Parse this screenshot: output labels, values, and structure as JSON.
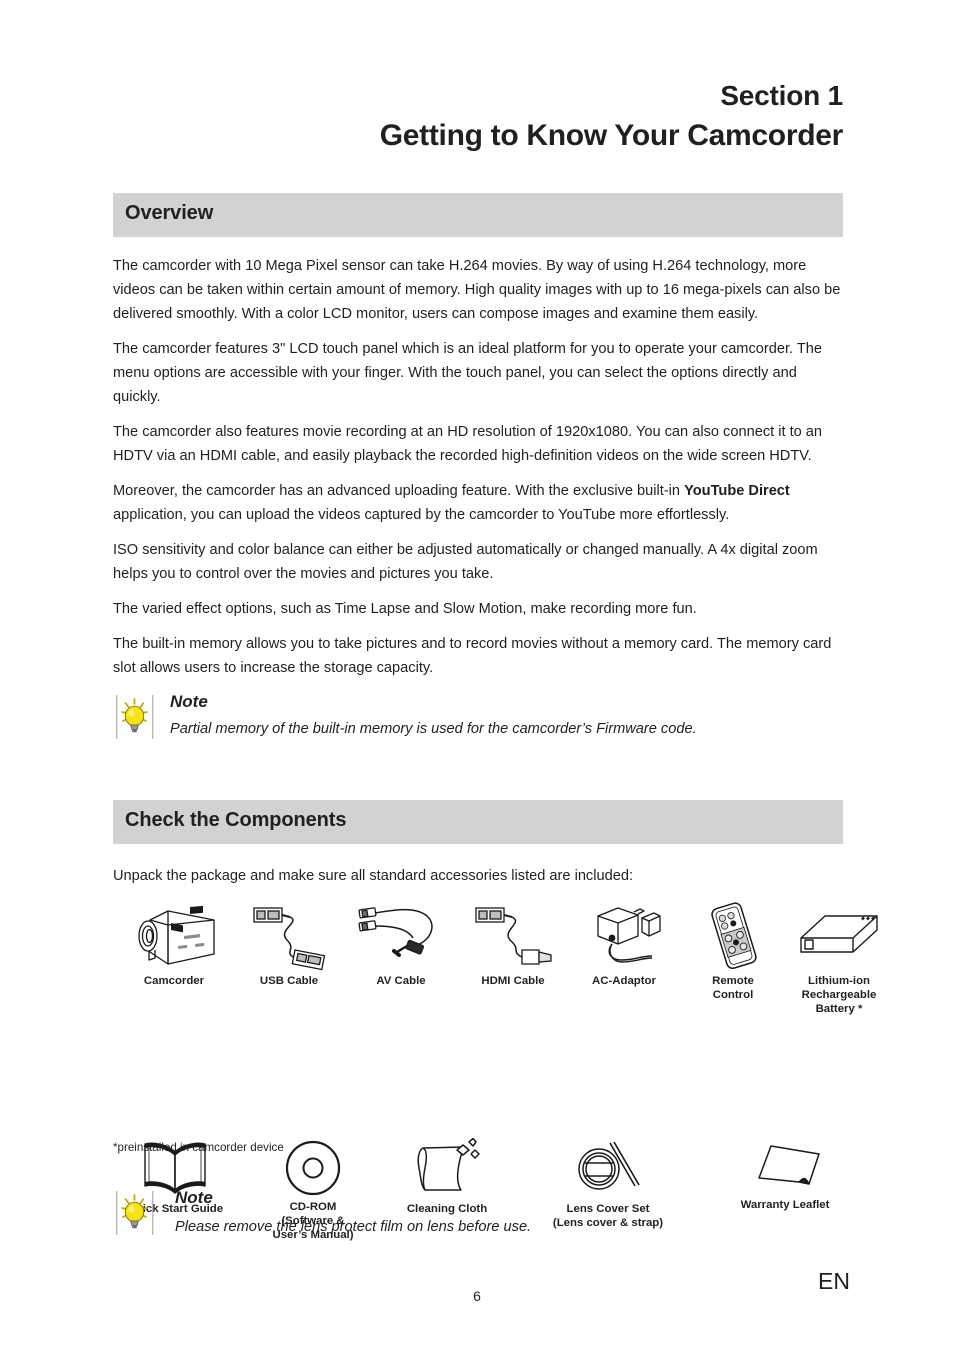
{
  "header": {
    "section_label": "Section 1",
    "section_title": "Getting to Know Your Camcorder"
  },
  "overview": {
    "band_title": "Overview",
    "paragraphs": [
      "The camcorder with 10 Mega Pixel sensor can take H.264 movies. By way of using H.264 technology, more videos can be taken within certain amount of memory. High quality images with up to 16 mega-pixels can also be delivered smoothly. With a color LCD monitor, users can compose images and examine them easily.",
      "The camcorder features 3\" LCD touch panel which is an ideal platform for you to operate your camcorder. The menu options are accessible with your finger. With the touch panel, you can select the options directly and quickly.",
      "The camcorder also features movie recording at an HD resolution of 1920x1080. You can also connect it to an HDTV via an HDMI cable, and easily playback the recorded high-definition videos on the wide screen HDTV."
    ],
    "para_youtube_pre": "Moreover, the camcorder has an advanced uploading feature. With the exclusive built-in ",
    "para_youtube_bold": "YouTube Direct",
    "para_youtube_post": " application, you can upload the videos captured by the camcorder to YouTube more effortlessly.",
    "paragraphs_after": [
      "ISO sensitivity and color balance can either be adjusted automatically or changed manually. A 4x digital zoom helps you to control over the movies and pictures you take.",
      "The varied effect options, such as Time Lapse and Slow Motion, make recording more fun.",
      "The built-in memory allows you to take pictures and to record movies without a memory card. The memory card slot allows users to increase the storage capacity."
    ]
  },
  "note_1": {
    "title": "Note",
    "body": "Partial memory of the built-in memory is used for the camcorder’s Firmware code.",
    "icon": "lightbulb-icon"
  },
  "components": {
    "band_title": "Check the Components",
    "intro": "Unpack the package and make sure all standard accessories listed are included:",
    "footnote": "*preinstalled in camcorder device",
    "row1": [
      {
        "label": "Camcorder",
        "icon": "camcorder-icon"
      },
      {
        "label": "USB Cable",
        "icon": "usb-cable-icon"
      },
      {
        "label": "AV Cable",
        "icon": "av-cable-icon"
      },
      {
        "label": "HDMI Cable",
        "icon": "hdmi-cable-icon"
      },
      {
        "label": "AC-Adaptor",
        "icon": "ac-adaptor-icon"
      },
      {
        "label": "Remote\nControl",
        "icon": "remote-control-icon"
      },
      {
        "label": "Lithium-ion\nRechargeable\nBattery *",
        "icon": "battery-icon"
      }
    ],
    "row2": [
      {
        "label": "Quick Start Guide",
        "icon": "book-icon"
      },
      {
        "label": "CD-ROM\n(Software &\nUser’s Manual)",
        "icon": "cd-rom-icon"
      },
      {
        "label": "Cleaning Cloth",
        "icon": "cleaning-cloth-icon"
      },
      {
        "label": "Lens Cover Set\n(Lens cover & strap)",
        "icon": "lens-cover-icon"
      },
      {
        "label": "Warranty Leaflet",
        "icon": "warranty-leaflet-icon"
      }
    ]
  },
  "note_2": {
    "title": "Note",
    "body": "Please remove the lens protect film on lens before use.",
    "icon": "lightbulb-icon"
  },
  "footer": {
    "page_number": "6",
    "language": "EN"
  },
  "colors": {
    "band_gray": "#d2d2d2",
    "text": "#231f20",
    "bulb_yellow": "#f5e40a"
  }
}
